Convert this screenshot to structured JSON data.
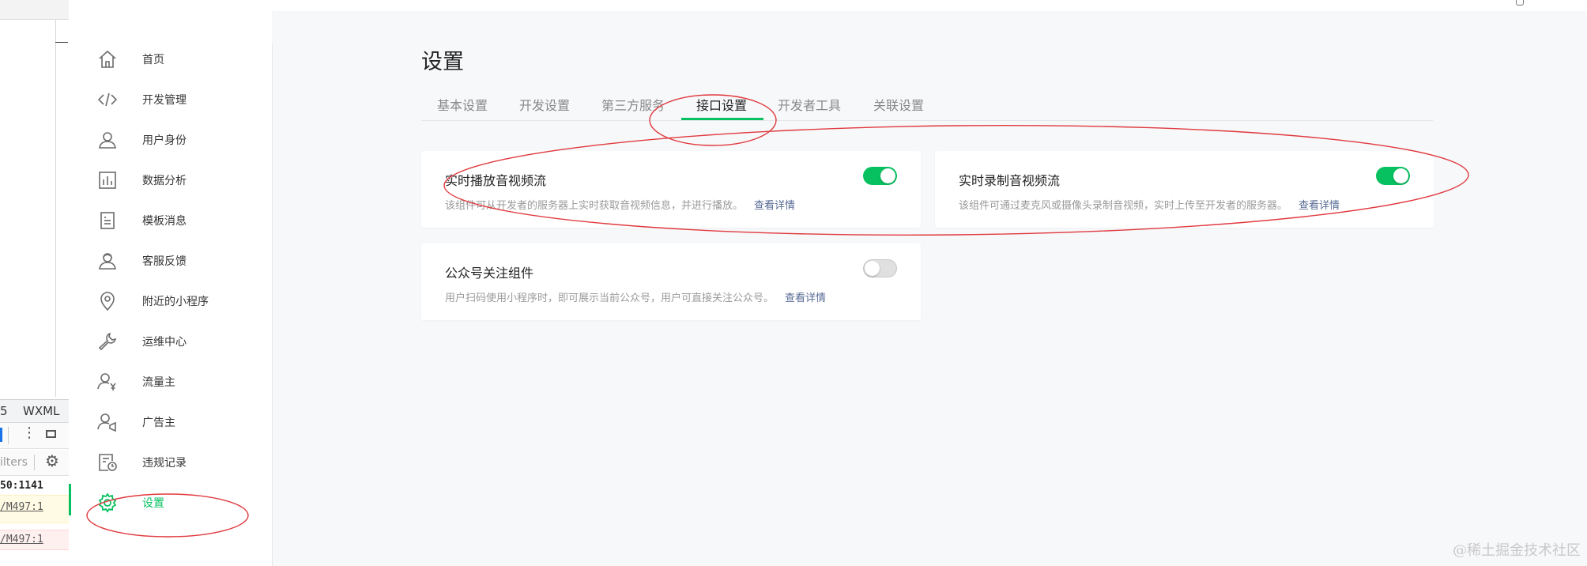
{
  "devtools": {
    "tab_partial": "5",
    "tab_wxml": "WXML",
    "filters_placeholder": "ilters",
    "log_line1": "50:1141",
    "log_link1": "/M497:1",
    "log_link2": "/M497:1"
  },
  "sidebar": {
    "items": [
      {
        "label": "首页",
        "icon": "home-icon"
      },
      {
        "label": "开发管理",
        "icon": "code-icon"
      },
      {
        "label": "用户身份",
        "icon": "user-icon"
      },
      {
        "label": "数据分析",
        "icon": "bar-chart-icon"
      },
      {
        "label": "模板消息",
        "icon": "document-icon"
      },
      {
        "label": "客服反馈",
        "icon": "customer-service-icon"
      },
      {
        "label": "附近的小程序",
        "icon": "location-pin-icon"
      },
      {
        "label": "运维中心",
        "icon": "wrench-icon"
      },
      {
        "label": "流量主",
        "icon": "user-yen-icon"
      },
      {
        "label": "广告主",
        "icon": "user-megaphone-icon"
      },
      {
        "label": "违规记录",
        "icon": "record-clock-icon"
      },
      {
        "label": "设置",
        "icon": "gear-icon",
        "active": true
      }
    ]
  },
  "main": {
    "title": "设置",
    "tabs": [
      {
        "label": "基本设置"
      },
      {
        "label": "开发设置"
      },
      {
        "label": "第三方服务"
      },
      {
        "label": "接口设置",
        "active": true
      },
      {
        "label": "开发者工具"
      },
      {
        "label": "关联设置"
      }
    ],
    "cards": [
      {
        "title": "实时播放音视频流",
        "desc": "该组件可从开发者的服务器上实时获取音视频信息，并进行播放。",
        "link": "查看详情",
        "enabled": true
      },
      {
        "title": "实时录制音视频流",
        "desc": "该组件可通过麦克风或摄像头录制音视频，实时上传至开发者的服务器。",
        "link": "查看详情",
        "enabled": true
      },
      {
        "title": "公众号关注组件",
        "desc": "用户扫码使用小程序时，即可展示当前公众号，用户可直接关注公众号。",
        "link": "查看详情",
        "enabled": false
      }
    ]
  },
  "watermark": "@稀土掘金技术社区",
  "colors": {
    "accent": "#07c160",
    "link": "#576b95",
    "annotation": "#e0393e"
  }
}
